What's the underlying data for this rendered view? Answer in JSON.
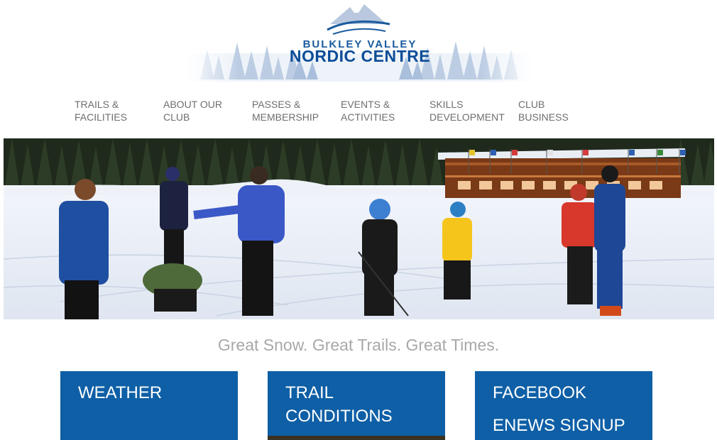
{
  "logo": {
    "line1": "BULKLEY VALLEY",
    "line2": "NORDIC CENTRE",
    "icon": "mountain-logo-icon"
  },
  "nav": [
    {
      "line1": "TRAILS &",
      "line2": "FACILITIES"
    },
    {
      "line1": "ABOUT OUR",
      "line2": "CLUB"
    },
    {
      "line1": "PASSES &",
      "line2": "MEMBERSHIP"
    },
    {
      "line1": "EVENTS &",
      "line2": "ACTIVITIES"
    },
    {
      "line1": "SKILLS",
      "line2": "DEVELOPMENT"
    },
    {
      "line1": "CLUB",
      "line2": "BUSINESS"
    }
  ],
  "hero": {
    "description_icon": "ski-lodge-photo"
  },
  "tagline": "Great Snow. Great Trails. Great Times.",
  "tiles": {
    "weather": {
      "label": "WEATHER"
    },
    "trail": {
      "line1": "TRAIL",
      "line2": "CONDITIONS"
    },
    "social": {
      "line1": "FACEBOOK",
      "line2": "ENEWS SIGNUP"
    }
  },
  "colors": {
    "brand_blue": "#0e5fa6",
    "nav_text": "#6e6e6e",
    "tagline": "#a8a8a8"
  }
}
